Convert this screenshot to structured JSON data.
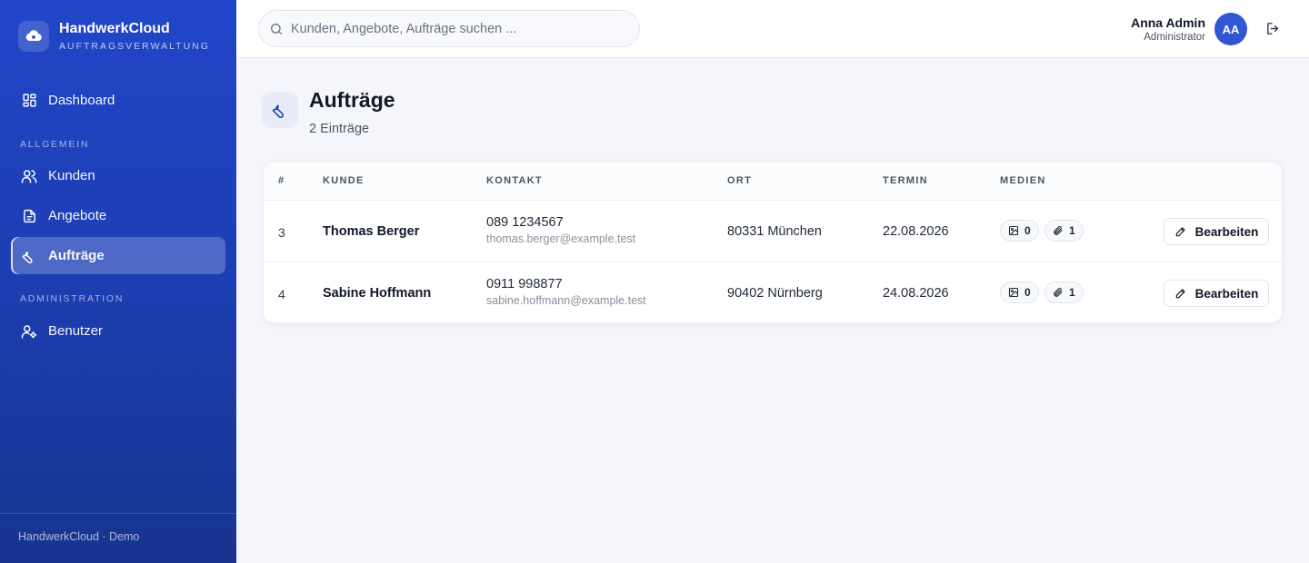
{
  "brand": {
    "name": "HandwerkCloud",
    "subtitle": "AUFTRAGSVERWALTUNG"
  },
  "sidebar": {
    "dashboard": "Dashboard",
    "section_general": "ALLGEMEIN",
    "kunden": "Kunden",
    "angebote": "Angebote",
    "auftraege": "Aufträge",
    "section_admin": "ADMINISTRATION",
    "benutzer": "Benutzer",
    "footer": "HandwerkCloud · Demo"
  },
  "search": {
    "placeholder": "Kunden, Angebote, Aufträge suchen ..."
  },
  "user": {
    "name": "Anna Admin",
    "role": "Administrator",
    "initials": "AA"
  },
  "page": {
    "title": "Aufträge",
    "count": "2 Einträge"
  },
  "table": {
    "headers": {
      "num": "#",
      "kunde": "KUNDE",
      "kontakt": "KONTAKT",
      "ort": "ORT",
      "termin": "TERMIN",
      "medien": "MEDIEN"
    },
    "rows": [
      {
        "num": "3",
        "kunde": "Thomas Berger",
        "phone": "089 1234567",
        "email": "thomas.berger@example.test",
        "ort": "80331 München",
        "termin": "22.08.2026",
        "images": "0",
        "attachments": "1",
        "edit": "Bearbeiten"
      },
      {
        "num": "4",
        "kunde": "Sabine Hoffmann",
        "phone": "0911 998877",
        "email": "sabine.hoffmann@example.test",
        "ort": "90402 Nürnberg",
        "termin": "24.08.2026",
        "images": "0",
        "attachments": "1",
        "edit": "Bearbeiten"
      }
    ]
  },
  "colors": {
    "sidebar_top": "#2146c8",
    "sidebar_bottom": "#17348f",
    "accent": "#3056d3",
    "background": "#f5f6fb"
  },
  "icons": {
    "brand": "cloud-gear-icon",
    "dashboard": "grid-icon",
    "kunden": "users-icon",
    "angebote": "document-icon",
    "auftraege": "wrench-icon",
    "benutzer": "user-gear-icon",
    "search": "search-icon",
    "logout": "logout-icon",
    "image": "image-icon",
    "attachment": "paperclip-icon",
    "edit": "pencil-icon"
  }
}
